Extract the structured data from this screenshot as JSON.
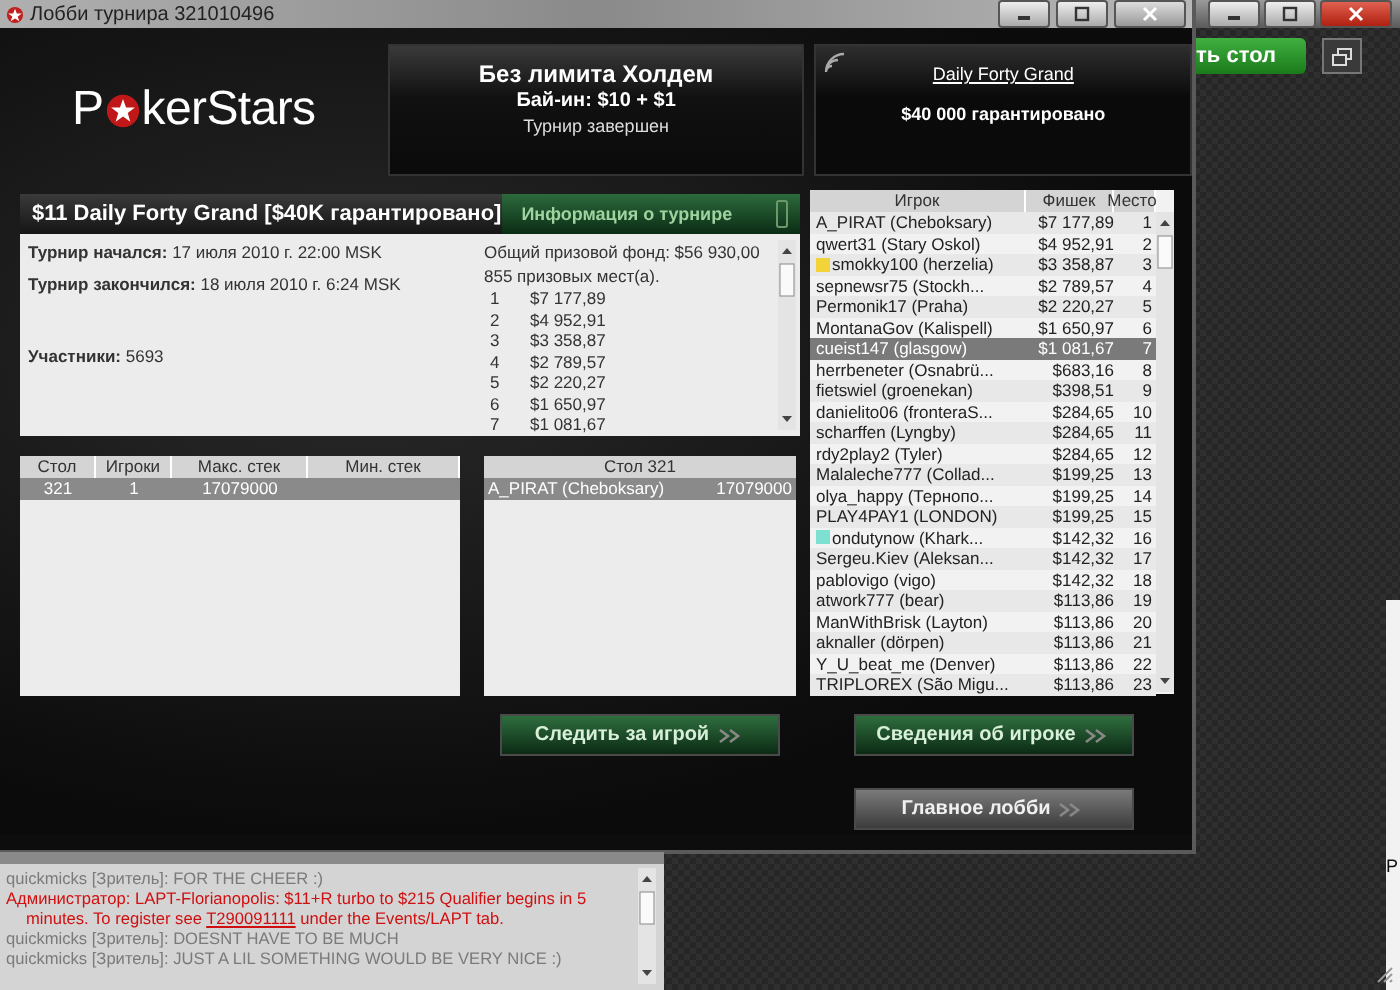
{
  "background_window": {
    "button": "ть стол",
    "edge_text": "Р"
  },
  "window": {
    "title": "Лобби турнира 321010496"
  },
  "header": {
    "logo": [
      "P",
      "kerStars"
    ],
    "game": {
      "title": "Без лимита Холдем",
      "buy_in": "Бай-ин: $10 + $1",
      "status": "Турнир завершен"
    },
    "event": {
      "link": "Daily Forty Grand",
      "guarantee": "$40 000 гарантировано"
    }
  },
  "tournament_panel": {
    "title": "$11 Daily Forty Grand [$40K гарантировано]",
    "tab": {
      "label": "Информация о турнире",
      "selected": true
    },
    "info": [
      "**Турнир начался:** 17 июля 2010 г. 22:00 MSK",
      "**Турнир закончился:** 18 июля 2010 г. 6:24 MSK"
    ],
    "participants": "**Участники:** 5693",
    "prize_pool": "Общий призовой фонд: $56 930,00",
    "paid_places": "855 призовых мест(а).",
    "prizes": [
      {
        "place": "1",
        "amount": "$7 177,89"
      },
      {
        "place": "2",
        "amount": "$4 952,91"
      },
      {
        "place": "3",
        "amount": "$3 358,87"
      },
      {
        "place": "4",
        "amount": "$2 789,57"
      },
      {
        "place": "5",
        "amount": "$2 220,27"
      },
      {
        "place": "6",
        "amount": "$1 650,97"
      },
      {
        "place": "7",
        "amount": "$1 081,67"
      }
    ]
  },
  "tables": {
    "columns": [
      "Стол",
      "Игроки",
      "Макс. стек",
      "Мин. стек"
    ],
    "rows": [
      {
        "cells": [
          "321",
          "1",
          "17079000"
        ],
        "selected": true
      }
    ]
  },
  "table_detail": {
    "title": "Стол 321",
    "rows": [
      {
        "player": "A_PIRAT (Cheboksary)",
        "chips": "17079000",
        "selected": true
      }
    ]
  },
  "players": {
    "columns": [
      "Игрок",
      "Фишек",
      "Место"
    ],
    "rows": [
      {
        "name": "A_PIRAT (Cheboksary)",
        "chips": "$7 177,89",
        "place": "1",
        "selected": false
      },
      {
        "name": "qwert31 (Stary Oskol)",
        "chips": "$4 952,91",
        "place": "2",
        "selected": false
      },
      {
        "name": "smokky100 (herzelia)",
        "chips": "$3 358,87",
        "place": "3",
        "selected": false,
        "color": "#f2d43a"
      },
      {
        "name": "sepnewsr75 (Stockh...",
        "chips": "$2 789,57",
        "place": "4",
        "selected": false
      },
      {
        "name": "Permonik17 (Praha)",
        "chips": "$2 220,27",
        "place": "5",
        "selected": false
      },
      {
        "name": "MontanaGov (Kalispell)",
        "chips": "$1 650,97",
        "place": "6",
        "selected": false
      },
      {
        "name": "cueist147 (glasgow)",
        "chips": "$1 081,67",
        "place": "7",
        "selected": true
      },
      {
        "name": "herrbeneter (Osnabrü...",
        "chips": "$683,16",
        "place": "8",
        "selected": false
      },
      {
        "name": "fietswiel (groenekan)",
        "chips": "$398,51",
        "place": "9",
        "selected": false
      },
      {
        "name": "danielito06 (fronteraS...",
        "chips": "$284,65",
        "place": "10",
        "selected": false
      },
      {
        "name": "scharffen (Lyngby)",
        "chips": "$284,65",
        "place": "11",
        "selected": false
      },
      {
        "name": "rdy2play2 (Tyler)",
        "chips": "$284,65",
        "place": "12",
        "selected": false
      },
      {
        "name": "Malaleche777 (Collad...",
        "chips": "$199,25",
        "place": "13",
        "selected": false
      },
      {
        "name": "olya_happy (Тернопо...",
        "chips": "$199,25",
        "place": "14",
        "selected": false
      },
      {
        "name": "PLAY4PAY1 (LONDON)",
        "chips": "$199,25",
        "place": "15",
        "selected": false
      },
      {
        "name": "ondutynow (Khark...",
        "chips": "$142,32",
        "place": "16",
        "selected": false,
        "color": "#7ee0d0"
      },
      {
        "name": "Sergeu.Kiev (Aleksan...",
        "chips": "$142,32",
        "place": "17",
        "selected": false
      },
      {
        "name": "pablovigo (vigo)",
        "chips": "$142,32",
        "place": "18",
        "selected": false
      },
      {
        "name": "atwork777 (bear)",
        "chips": "$113,86",
        "place": "19",
        "selected": false
      },
      {
        "name": "ManWithBrisk (Layton)",
        "chips": "$113,86",
        "place": "20",
        "selected": false
      },
      {
        "name": "aknaller (dörpen)",
        "chips": "$113,86",
        "place": "21",
        "selected": false
      },
      {
        "name": "Y_U_beat_me (Denver)",
        "chips": "$113,86",
        "place": "22",
        "selected": false
      },
      {
        "name": "TRIPLOREX (São Migu...",
        "chips": "$113,86",
        "place": "23",
        "selected": false
      }
    ]
  },
  "buttons": [
    {
      "label": "Следить за игрой",
      "kind": "green"
    },
    {
      "label": "Сведения об игроке",
      "kind": "green"
    },
    {
      "label": "Главное лобби",
      "kind": "gray"
    }
  ],
  "chat": {
    "messages": [
      {
        "kind": "viewer",
        "text": "quickmicks [Зритель]: FOR THE CHEER :)"
      },
      {
        "kind": "admin",
        "text": "Администратор: LAPT-Florianopolis: $11+R turbo to $215 Qualifier begins in 5 minutes. To register see",
        "link": "T290091111",
        "after": "under the Events/LAPT tab."
      },
      {
        "kind": "viewer",
        "text": "quickmicks [Зритель]: DOESNT HAVE TO BE MUCH"
      },
      {
        "kind": "viewer",
        "text": "quickmicks [Зритель]: JUST A LIL SOMETHING WOULD BE VERY NICE :)"
      }
    ]
  }
}
